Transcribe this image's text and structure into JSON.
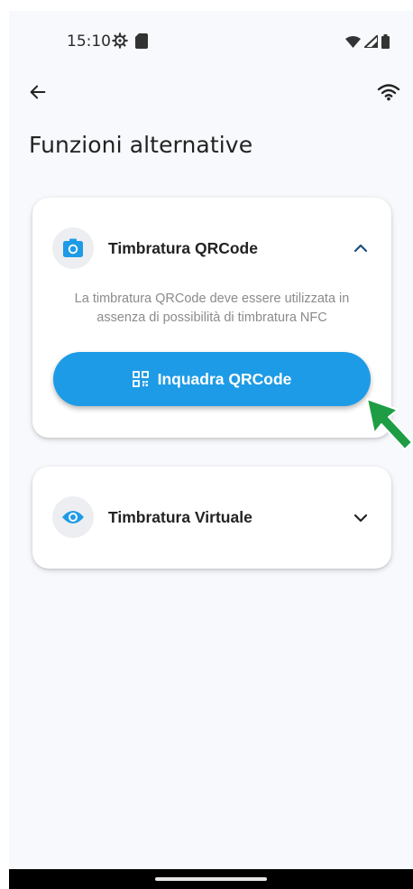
{
  "status_bar": {
    "time": "15:10",
    "left_icons": [
      "settings-gear-icon",
      "sim-card-icon"
    ],
    "right_icons": [
      "wifi-signal-icon",
      "cell-signal-icon",
      "battery-icon"
    ]
  },
  "app_bar": {
    "back_icon": "arrow-back-icon",
    "action_icon": "wifi-icon"
  },
  "page": {
    "title": "Funzioni alternative"
  },
  "cards": {
    "qr": {
      "title": "Timbratura QRCode",
      "icon": "camera-icon",
      "expanded": true,
      "chevron": "chevron-up-icon",
      "description": "La timbratura QRCode deve essere utilizzata in assenza di possibilità di timbratura NFC",
      "button_label": "Inquadra QRCode",
      "button_icon": "qr-code-icon"
    },
    "virtual": {
      "title": "Timbratura Virtuale",
      "icon": "eye-icon",
      "expanded": false,
      "chevron": "chevron-down-icon"
    }
  },
  "colors": {
    "accent": "#1e9be6",
    "background": "#f7f9fc",
    "pointer": "#1f9d45"
  }
}
